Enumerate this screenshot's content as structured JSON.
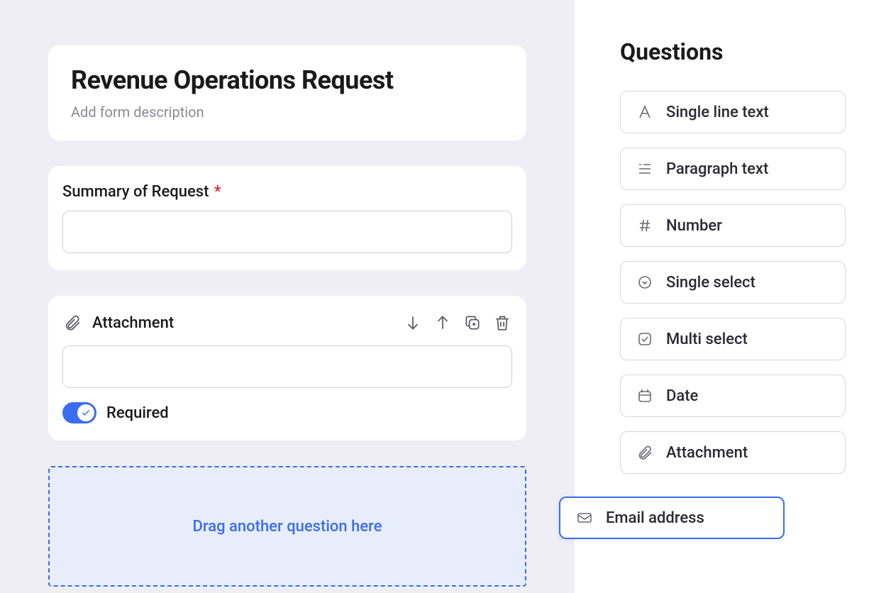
{
  "form": {
    "title": "Revenue Operations Request",
    "description_placeholder": "Add form description"
  },
  "fields": {
    "summary": {
      "label": "Summary of Request",
      "required": true
    },
    "attachment": {
      "label": "Attachment",
      "required_label": "Required",
      "required_on": true
    }
  },
  "dropzone": {
    "text": "Drag another question here"
  },
  "sidebar": {
    "title": "Questions",
    "items": [
      {
        "id": "single-line-text",
        "label": "Single line text",
        "icon": "text-a-icon"
      },
      {
        "id": "paragraph-text",
        "label": "Paragraph text",
        "icon": "paragraph-icon"
      },
      {
        "id": "number",
        "label": "Number",
        "icon": "hash-icon"
      },
      {
        "id": "single-select",
        "label": "Single select",
        "icon": "caret-circle-icon"
      },
      {
        "id": "multi-select",
        "label": "Multi select",
        "icon": "checkbox-icon"
      },
      {
        "id": "date",
        "label": "Date",
        "icon": "calendar-icon"
      },
      {
        "id": "attachment",
        "label": "Attachment",
        "icon": "paperclip-icon"
      },
      {
        "id": "email-address",
        "label": "Email address",
        "icon": "mail-icon",
        "dragging": true
      }
    ]
  }
}
